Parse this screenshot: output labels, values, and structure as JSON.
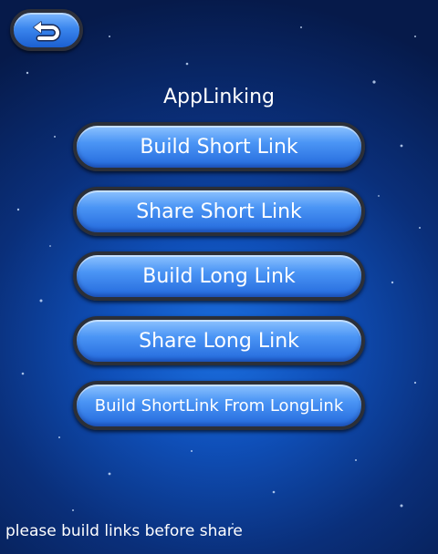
{
  "header": {
    "back_icon": "back-arrow-icon"
  },
  "title": "AppLinking",
  "buttons": {
    "build_short": "Build Short Link",
    "share_short": "Share Short Link",
    "build_long": "Build Long Link",
    "share_long": "Share Long Link",
    "build_short_from_long": "Build ShortLink From LongLink"
  },
  "status": "please build links before share",
  "colors": {
    "button_blue": "#3b86ee",
    "background": "#0a2f7a"
  }
}
